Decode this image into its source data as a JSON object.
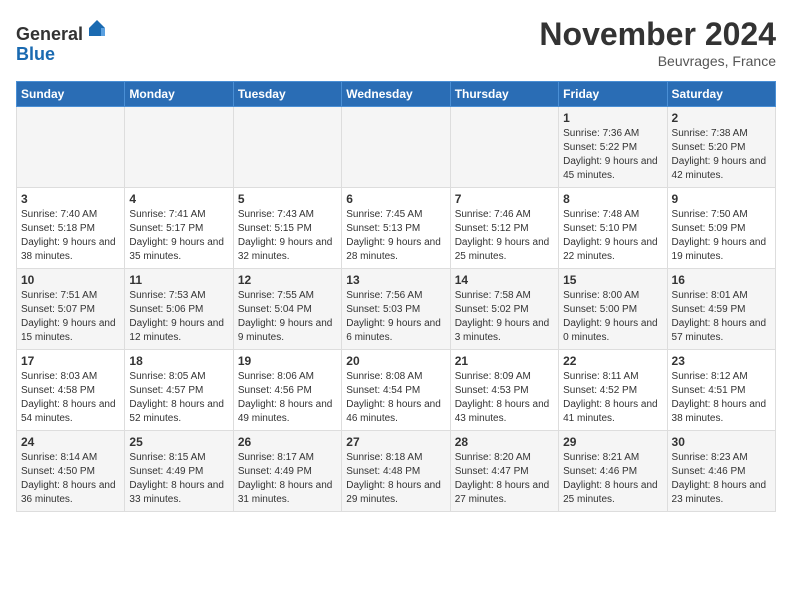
{
  "header": {
    "logo_line1": "General",
    "logo_line2": "Blue",
    "month_title": "November 2024",
    "location": "Beuvrages, France"
  },
  "days_of_week": [
    "Sunday",
    "Monday",
    "Tuesday",
    "Wednesday",
    "Thursday",
    "Friday",
    "Saturday"
  ],
  "weeks": [
    [
      {
        "day": "",
        "info": ""
      },
      {
        "day": "",
        "info": ""
      },
      {
        "day": "",
        "info": ""
      },
      {
        "day": "",
        "info": ""
      },
      {
        "day": "",
        "info": ""
      },
      {
        "day": "1",
        "info": "Sunrise: 7:36 AM\nSunset: 5:22 PM\nDaylight: 9 hours and 45 minutes."
      },
      {
        "day": "2",
        "info": "Sunrise: 7:38 AM\nSunset: 5:20 PM\nDaylight: 9 hours and 42 minutes."
      }
    ],
    [
      {
        "day": "3",
        "info": "Sunrise: 7:40 AM\nSunset: 5:18 PM\nDaylight: 9 hours and 38 minutes."
      },
      {
        "day": "4",
        "info": "Sunrise: 7:41 AM\nSunset: 5:17 PM\nDaylight: 9 hours and 35 minutes."
      },
      {
        "day": "5",
        "info": "Sunrise: 7:43 AM\nSunset: 5:15 PM\nDaylight: 9 hours and 32 minutes."
      },
      {
        "day": "6",
        "info": "Sunrise: 7:45 AM\nSunset: 5:13 PM\nDaylight: 9 hours and 28 minutes."
      },
      {
        "day": "7",
        "info": "Sunrise: 7:46 AM\nSunset: 5:12 PM\nDaylight: 9 hours and 25 minutes."
      },
      {
        "day": "8",
        "info": "Sunrise: 7:48 AM\nSunset: 5:10 PM\nDaylight: 9 hours and 22 minutes."
      },
      {
        "day": "9",
        "info": "Sunrise: 7:50 AM\nSunset: 5:09 PM\nDaylight: 9 hours and 19 minutes."
      }
    ],
    [
      {
        "day": "10",
        "info": "Sunrise: 7:51 AM\nSunset: 5:07 PM\nDaylight: 9 hours and 15 minutes."
      },
      {
        "day": "11",
        "info": "Sunrise: 7:53 AM\nSunset: 5:06 PM\nDaylight: 9 hours and 12 minutes."
      },
      {
        "day": "12",
        "info": "Sunrise: 7:55 AM\nSunset: 5:04 PM\nDaylight: 9 hours and 9 minutes."
      },
      {
        "day": "13",
        "info": "Sunrise: 7:56 AM\nSunset: 5:03 PM\nDaylight: 9 hours and 6 minutes."
      },
      {
        "day": "14",
        "info": "Sunrise: 7:58 AM\nSunset: 5:02 PM\nDaylight: 9 hours and 3 minutes."
      },
      {
        "day": "15",
        "info": "Sunrise: 8:00 AM\nSunset: 5:00 PM\nDaylight: 9 hours and 0 minutes."
      },
      {
        "day": "16",
        "info": "Sunrise: 8:01 AM\nSunset: 4:59 PM\nDaylight: 8 hours and 57 minutes."
      }
    ],
    [
      {
        "day": "17",
        "info": "Sunrise: 8:03 AM\nSunset: 4:58 PM\nDaylight: 8 hours and 54 minutes."
      },
      {
        "day": "18",
        "info": "Sunrise: 8:05 AM\nSunset: 4:57 PM\nDaylight: 8 hours and 52 minutes."
      },
      {
        "day": "19",
        "info": "Sunrise: 8:06 AM\nSunset: 4:56 PM\nDaylight: 8 hours and 49 minutes."
      },
      {
        "day": "20",
        "info": "Sunrise: 8:08 AM\nSunset: 4:54 PM\nDaylight: 8 hours and 46 minutes."
      },
      {
        "day": "21",
        "info": "Sunrise: 8:09 AM\nSunset: 4:53 PM\nDaylight: 8 hours and 43 minutes."
      },
      {
        "day": "22",
        "info": "Sunrise: 8:11 AM\nSunset: 4:52 PM\nDaylight: 8 hours and 41 minutes."
      },
      {
        "day": "23",
        "info": "Sunrise: 8:12 AM\nSunset: 4:51 PM\nDaylight: 8 hours and 38 minutes."
      }
    ],
    [
      {
        "day": "24",
        "info": "Sunrise: 8:14 AM\nSunset: 4:50 PM\nDaylight: 8 hours and 36 minutes."
      },
      {
        "day": "25",
        "info": "Sunrise: 8:15 AM\nSunset: 4:49 PM\nDaylight: 8 hours and 33 minutes."
      },
      {
        "day": "26",
        "info": "Sunrise: 8:17 AM\nSunset: 4:49 PM\nDaylight: 8 hours and 31 minutes."
      },
      {
        "day": "27",
        "info": "Sunrise: 8:18 AM\nSunset: 4:48 PM\nDaylight: 8 hours and 29 minutes."
      },
      {
        "day": "28",
        "info": "Sunrise: 8:20 AM\nSunset: 4:47 PM\nDaylight: 8 hours and 27 minutes."
      },
      {
        "day": "29",
        "info": "Sunrise: 8:21 AM\nSunset: 4:46 PM\nDaylight: 8 hours and 25 minutes."
      },
      {
        "day": "30",
        "info": "Sunrise: 8:23 AM\nSunset: 4:46 PM\nDaylight: 8 hours and 23 minutes."
      }
    ]
  ]
}
